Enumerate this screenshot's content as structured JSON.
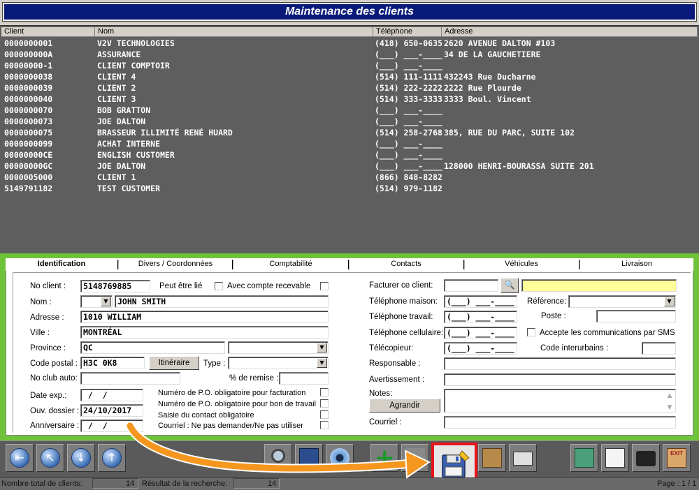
{
  "window": {
    "title": "Maintenance des clients"
  },
  "list": {
    "columns": [
      "Client",
      "Nom",
      "Téléphone",
      "Adresse"
    ],
    "rows": [
      [
        "0000000001",
        "V2V TECHNOLOGIES",
        "(418) 650-0635",
        "2620 AVENUE DALTON #103"
      ],
      [
        "000000000A",
        "ASSURANCE",
        "(___) ___-____",
        "34 DE LA GAUCHETIERE"
      ],
      [
        "00000000-1",
        "CLIENT COMPTOIR",
        "(___) ___-____",
        ""
      ],
      [
        "0000000038",
        "CLIENT 4",
        "(514) 111-1111",
        "432243 Rue Ducharne"
      ],
      [
        "0000000039",
        "CLIENT 2",
        "(514) 222-2222",
        "2222 Rue Plourde"
      ],
      [
        "0000000040",
        "CLIENT 3",
        "(514) 333-3333",
        "3333 Boul. Vincent"
      ],
      [
        "0000000070",
        "BOB GRATTON",
        "(___) ___-____",
        ""
      ],
      [
        "0000000073",
        "JOE DALTON",
        "(___) ___-____",
        ""
      ],
      [
        "0000000075",
        "BRASSEUR ILLIMITÉ RENÉ HUARD",
        "(514) 258-2768",
        "385, RUE DU PARC, SUITE 102"
      ],
      [
        "0000000099",
        "ACHAT INTERNE",
        "(___) ___-____",
        ""
      ],
      [
        "00000000CE",
        "ENGLISH CUSTOMER",
        "(___) ___-____",
        ""
      ],
      [
        "00000000GC",
        "JOE DALTON",
        "(___) ___-____",
        "128000 HENRI-BOURASSA SUITE 201"
      ],
      [
        "0000005000",
        "CLIENT 1",
        "(866) 848-8282",
        ""
      ],
      [
        "5149791182",
        "TEST CUSTOMER",
        "(514) 979-1182",
        ""
      ]
    ]
  },
  "tabs": [
    "Identification",
    "Divers / Coordonnées",
    "Comptabilité",
    "Contacts",
    "Véhicules",
    "Livraison"
  ],
  "form": {
    "no_client_label": "No client :",
    "no_client": "5148769885",
    "peut_etre_lie": "Peut être lié",
    "avec_compte": "Avec compte recevable",
    "nom_label": "Nom :",
    "nom": "JOHN SMITH",
    "adresse_label": "Adresse :",
    "adresse": "1010 WILLIAM",
    "ville_label": "Ville :",
    "ville": "MONTRÉAL",
    "province_label": "Province :",
    "province": "QC",
    "code_postal_label": "Code postal :",
    "code_postal": "H3C 0K8",
    "itineraire": "Itinéraire",
    "type_label": "Type :",
    "no_club_label": "No club auto:",
    "remise_label": "% de remise :",
    "date_exp_label": "Date exp.:",
    "date_exp": " /  /",
    "ouv_dossier_label": "Ouv. dossier :",
    "ouv_dossier": "24/10/2017",
    "anniversaire_label": "Anniversaire :",
    "anniversaire": " /  /",
    "po_facturation": "Numéro de P.O. obligatoire pour facturation",
    "po_bon_travail": "Numéro de P.O. obligatoire pour bon de travail",
    "saisie_contact": "Saisie du contact obligatoire",
    "courriel_ne_pas": "Courriel : Ne pas demander/Ne pas utiliser",
    "facturer_label": "Facturer ce client:",
    "tel_maison_label": "Téléphone maison:",
    "tel_maison": "(___) ___-____",
    "tel_travail_label": "Téléphone travail:",
    "tel_travail": "(___) ___-____",
    "tel_cell_label": "Téléphone cellulaire:",
    "tel_cell": "(___) ___-____",
    "telecopieur_label": "Télécopieur:",
    "telecopieur": "(___) ___-____",
    "reference_label": "Référence:",
    "poste_label": "Poste :",
    "sms_label": "Accepte les communications par SMS",
    "code_interurbains_label": "Code interurbains :",
    "responsable_label": "Responsable :",
    "avertissement_label": "Avertissement :",
    "notes_label": "Notes:",
    "agrandir": "Agrandir",
    "courriel_label": "Courriel :"
  },
  "status": {
    "total_label": "Nombre total de clients:",
    "total": "14",
    "resultat_label": "Résultat de la recherche:",
    "resultat": "14",
    "page": "Page : 1 / 1"
  },
  "colors": {
    "title_bg": "#0a1a7a",
    "form_border": "#6fc33a",
    "highlight": "#e8141c",
    "arrow": "#f5961e"
  }
}
